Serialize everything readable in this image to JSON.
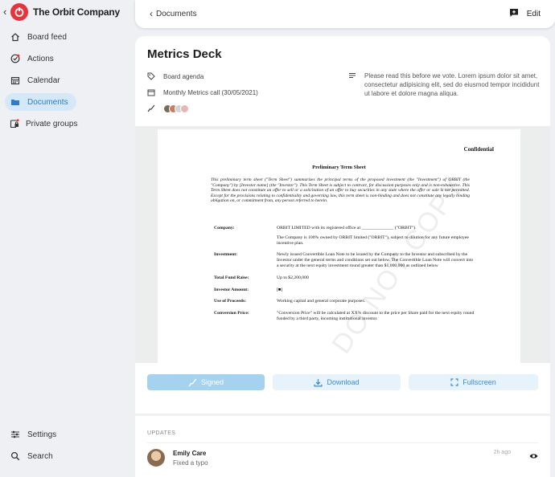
{
  "app": {
    "name": "The Orbit Company",
    "brand_color": "#e8333a",
    "accent_color": "#2b7bd0"
  },
  "sidebar": {
    "items": [
      {
        "label": "Board feed",
        "icon": "home-icon"
      },
      {
        "label": "Actions",
        "icon": "check-circle-icon"
      },
      {
        "label": "Calendar",
        "icon": "calendar-icon"
      },
      {
        "label": "Documents",
        "icon": "folder-icon",
        "active": true
      },
      {
        "label": "Private groups",
        "icon": "private-group-icon"
      }
    ],
    "bottom": [
      {
        "label": "Settings",
        "icon": "sliders-icon"
      },
      {
        "label": "Search",
        "icon": "search-icon"
      }
    ]
  },
  "topbar": {
    "back_label": "Documents",
    "edit_label": "Edit"
  },
  "document": {
    "title": "Metrics Deck",
    "tag": "Board agenda",
    "meeting": "Monthly Metrics call (30/05/2021)",
    "note": "Please read this before we vote. Lorem ipsum dolor sit amet, consectetur adipisicing elit, sed do eiusmod tempor incididunt ut labore et dolore magna aliqua."
  },
  "preview": {
    "confidential": "Confidential",
    "title": "Preliminary Term Sheet",
    "intro": "This preliminary term sheet (\"Term Sheet\") summarizes the principal terms of the proposed investment (the \"Investment\") of ORBIT (the \"Company\") by [Investor name] (the \"Investor\"). This Term Sheet is subject to contract, for discussion purposes only and is non-exhaustive. This Term Sheet does not constitute an offer to sell or a solicitation of an offer to buy securities in any state where the offer or sale is not permitted. Except for the provisions relating to confidentiality and governing law, this term sheet is non-binding and does not constitute any legally binding obligation on, or commitment from, any person referred to herein.",
    "company_label": "Company:",
    "company_value": "ORBIT LIMITED with its registered office at ______________ (\"ORBIT\").",
    "company_value2": "The Company is 100% owned by ORBIT limited (\"ORBIT\"), subject to dilution for any future employee incentive plan.",
    "investment_label": "Investment:",
    "investment_value": "Newly issued Convertible Loan Note to be issued by the Company to the Investor and subscribed by the Investor under the general terms and conditions set out below. The Convertible Loan Note will convert into a security at the next equity investment round greater than $1,000,000 as outlined below",
    "fund_label": "Total Fund Raise:",
    "fund_value": "Up to $2,200,000",
    "investor_label": "Investor Amount:",
    "investor_value": "[■]",
    "proceeds_label": "Use of Proceeds:",
    "proceeds_value": "Working capital and general corporate purposes.",
    "conversion_label": "Conversion Price:",
    "conversion_value": "\"Conversion Price\" will be calculated at XX% discount to the price per Share paid for the next equity round funded by a third party, incoming institutional investor.",
    "watermark": "DO NOT COPY"
  },
  "buttons": {
    "signed": "Signed",
    "download": "Download",
    "fullscreen": "Fullscreen"
  },
  "updates": {
    "header": "UPDATES",
    "items": [
      {
        "name": "Emily Care",
        "text": "Fixed a typo",
        "time": "2h ago"
      }
    ]
  }
}
